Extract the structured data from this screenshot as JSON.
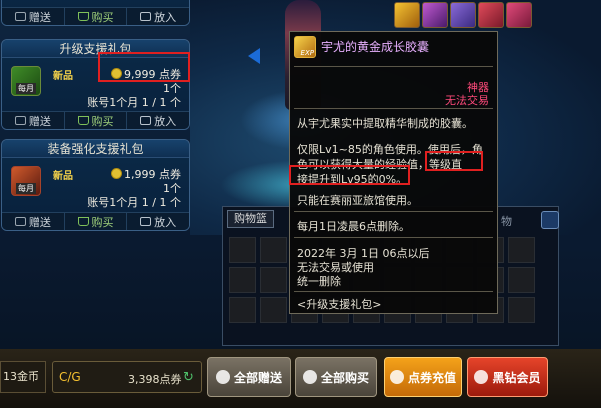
{
  "cards": [
    {
      "actions": {
        "gift": "赠送",
        "buy": "购买",
        "basket": "放入"
      }
    },
    {
      "title": "升级支援礼包",
      "badge_new": "新品",
      "thumb_label": "每月",
      "price_value": "9,999",
      "price_unit": "点券",
      "count": "1个",
      "limit": "账号1个月 1 / 1 个",
      "actions": {
        "gift": "赠送",
        "buy": "购买",
        "basket": "放入"
      }
    },
    {
      "title": "装备强化支援礼包",
      "badge_new": "新品",
      "thumb_label": "每月",
      "price_value": "1,999",
      "price_unit": "点券",
      "count": "1个",
      "limit": "账号1个月 1 / 1 个",
      "actions": {
        "gift": "赠送",
        "buy": "购买",
        "basket": "放入"
      }
    }
  ],
  "header_icons": [
    "exp-box-icon",
    "skill-box-icon",
    "clear-box-icon",
    "clear-box-icon",
    "clear-box-icon"
  ],
  "tooltip": {
    "item_name": "宇尤的黄金成长胶囊",
    "icon_tag": "EXP",
    "rarity": "神器",
    "trade_status": "无法交易",
    "description": "从宇尤果实中提取精华制成的胶囊。",
    "usage_line1": "仅限Lv1~85的角色使用。使用后，角",
    "usage_line2": "色可以获得大量的经验值，等级直",
    "usage_line3": "接提升到Lv95的0%。",
    "region": "只能在赛丽亚旅馆使用。",
    "delete_note": "每月1日凌晨6点删除。",
    "date_line1": "2022年 3月 1日 06点以后",
    "date_line2": "无法交易或使用",
    "date_line3": "统一删除",
    "source": "<升级支援礼包>"
  },
  "cart": {
    "tab_label": "购物篮",
    "tab2_label": "物"
  },
  "bottom": {
    "gold": "13金币",
    "points_value": "3,398点券",
    "btn_gift_all": "全部赠送",
    "btn_buy_all": "全部购买",
    "btn_recharge": "点券充值",
    "btn_vip": "黑钻会员"
  }
}
